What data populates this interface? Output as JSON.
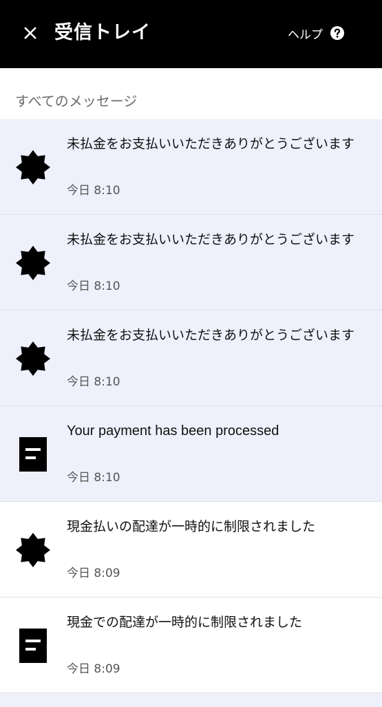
{
  "header": {
    "title": "受信トレイ",
    "close_icon": "close-icon",
    "help_label": "ヘルプ",
    "help_icon": "question-circle-icon"
  },
  "section": {
    "title": "すべてのメッセージ"
  },
  "messages": [
    {
      "text": "未払金をお支払いいただきありがとうございます",
      "time": "今日 8:10",
      "icon": "star-badge-icon",
      "unread": true
    },
    {
      "text": "未払金をお支払いいただきありがとうございます",
      "time": "今日 8:10",
      "icon": "star-badge-icon",
      "unread": true
    },
    {
      "text": "未払金をお支払いいただきありがとうございます",
      "time": "今日 8:10",
      "icon": "star-badge-icon",
      "unread": true
    },
    {
      "text": "Your payment has been processed",
      "time": "今日 8:10",
      "icon": "receipt-icon",
      "unread": true
    },
    {
      "text": "現金払いの配達が一時的に制限されました",
      "time": "今日 8:09",
      "icon": "star-badge-icon",
      "unread": false
    },
    {
      "text": "現金での配達が一時的に制限されました",
      "time": "今日 8:09",
      "icon": "receipt-icon",
      "unread": false
    }
  ],
  "colors": {
    "header_bg": "#000000",
    "unread_bg": "#eef0fc",
    "read_bg": "#ffffff",
    "divider": "#e2e2e8"
  }
}
